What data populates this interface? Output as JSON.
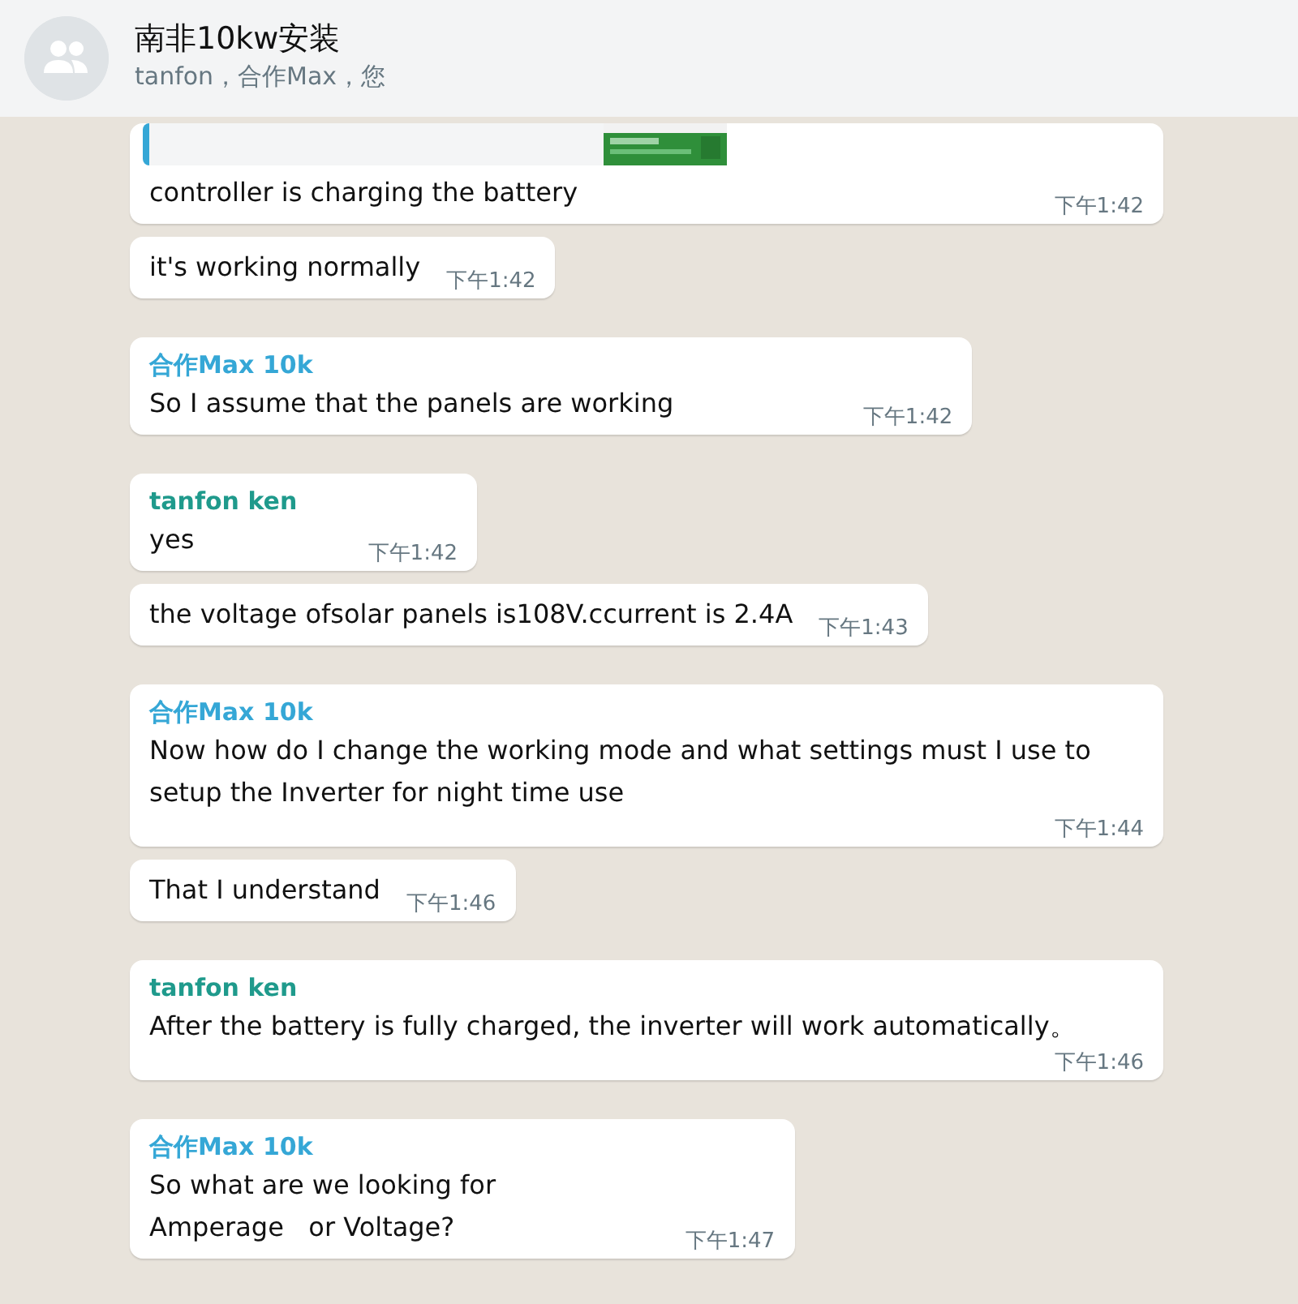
{
  "header": {
    "title": "南非10kw安装",
    "subtitle": "tanfon，合作Max，您"
  },
  "messages": [
    {
      "kind": "quoted",
      "text": "controller is charging the battery",
      "time": "下午1:42"
    },
    {
      "text": "it's working normally",
      "time": "下午1:42"
    },
    {
      "sender": "合作Max 10k",
      "color": "#35a7d6",
      "text": "So I assume that the panels are working",
      "time": "下午1:42"
    },
    {
      "sender": "tanfon ken",
      "color": "#1f9a8c",
      "text": "yes",
      "time": "下午1:42"
    },
    {
      "text": "the voltage ofsolar panels is108V.ccurrent is 2.4A",
      "time": "下午1:43"
    },
    {
      "sender": "合作Max 10k",
      "color": "#35a7d6",
      "text": "Now how do I change the working mode and what settings must I use to setup the Inverter for night time use",
      "time": "下午1:44"
    },
    {
      "text": "That I understand",
      "time": "下午1:46"
    },
    {
      "sender": "tanfon ken",
      "color": "#1f9a8c",
      "text": "After the battery is fully charged, the inverter will work automatically。",
      "time": "下午1:46"
    },
    {
      "sender": "合作Max 10k",
      "color": "#35a7d6",
      "text": "So what are we looking for\nAmperage   or Voltage?",
      "time": "下午1:47"
    }
  ]
}
